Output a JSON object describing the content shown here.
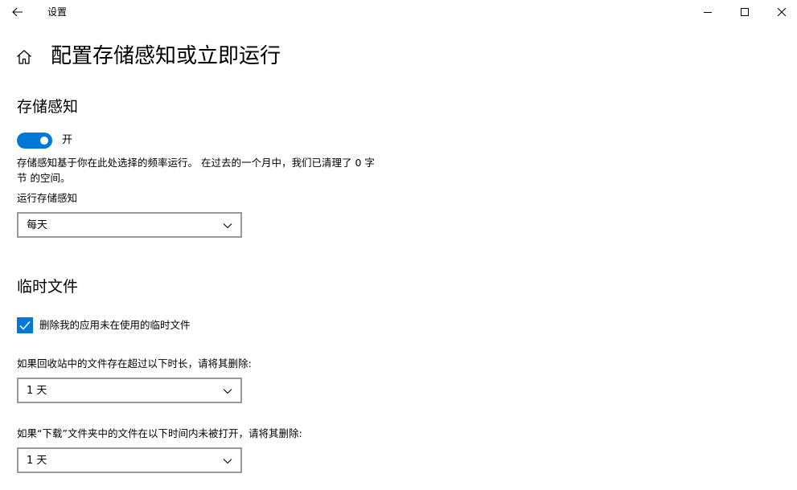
{
  "window": {
    "title": "设置",
    "controls": [
      "minimize",
      "maximize",
      "close"
    ]
  },
  "page": {
    "title": "配置存储感知或立即运行"
  },
  "storage_sense": {
    "heading": "存储感知",
    "toggle_state_label": "开",
    "toggle_on": true,
    "description": "存储感知基于你在此处选择的频率运行。 在过去的一个月中，我们已清理了 0 字节 的空间。",
    "run_label": "运行存储感知",
    "run_value": "每天"
  },
  "temp_files": {
    "heading": "临时文件",
    "delete_unused_label": "删除我的应用未在使用的临时文件",
    "delete_unused_checked": true,
    "recycle_bin_label": "如果回收站中的文件存在超过以下时长，请将其删除:",
    "recycle_bin_value": "1 天",
    "downloads_label": "如果“下载”文件夹中的文件在以下时间内未被打开，请将其删除:",
    "downloads_value": "1 天"
  },
  "colors": {
    "accent": "#0078d7",
    "border": "#999999"
  }
}
